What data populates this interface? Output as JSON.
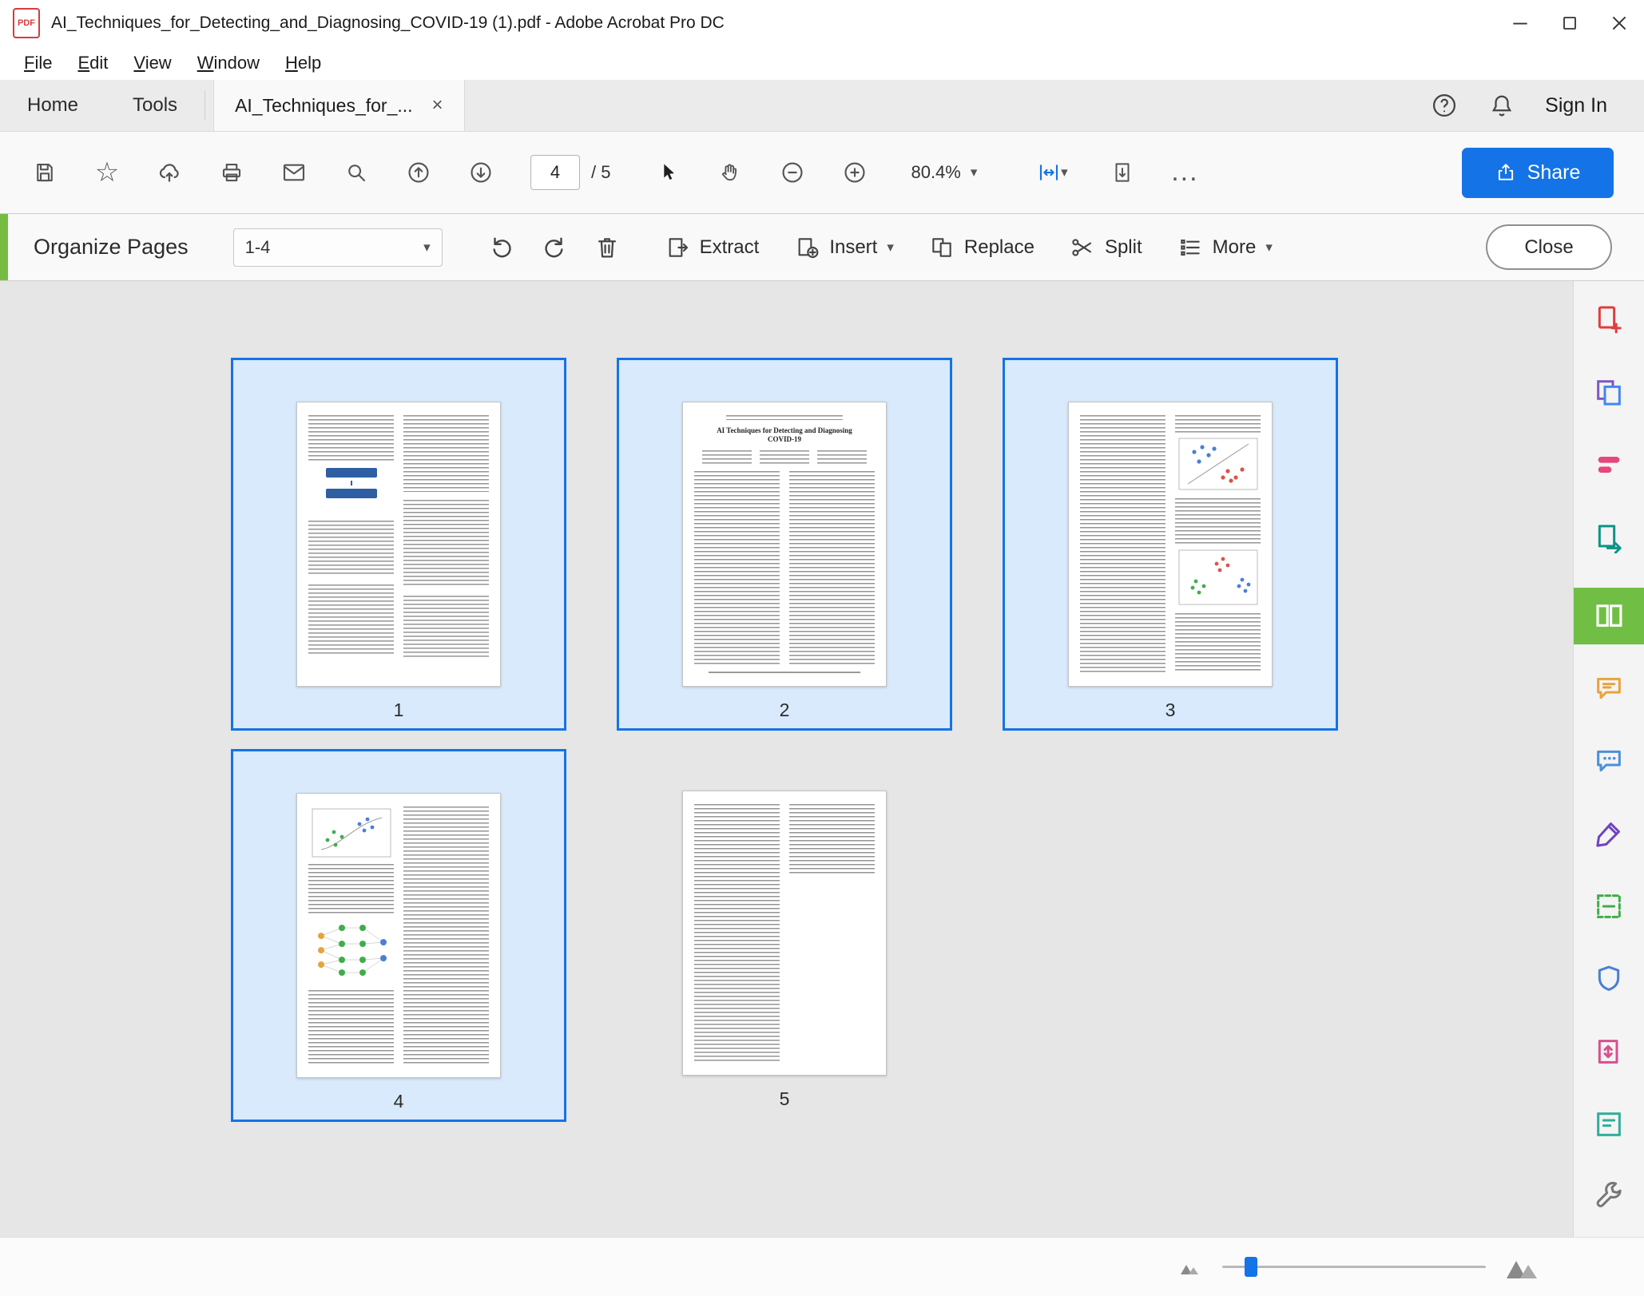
{
  "window": {
    "title": "AI_Techniques_for_Detecting_and_Diagnosing_COVID-19 (1).pdf - Adobe Acrobat Pro DC",
    "pdf_badge": "PDF"
  },
  "menu": {
    "items": [
      "File",
      "Edit",
      "View",
      "Window",
      "Help"
    ]
  },
  "tabbar": {
    "home": "Home",
    "tools": "Tools",
    "document_tab": "AI_Techniques_for_...",
    "sign_in": "Sign In"
  },
  "toolbar": {
    "page_current": "4",
    "page_total": "/ 5",
    "zoom_level": "80.4%",
    "share": "Share",
    "more": "..."
  },
  "organize": {
    "title": "Organize Pages",
    "page_range": "1-4",
    "extract": "Extract",
    "insert": "Insert",
    "replace": "Replace",
    "split": "Split",
    "more": "More",
    "close": "Close"
  },
  "document": {
    "page2_title_line1": "AI Techniques for Detecting and Diagnosing",
    "page2_title_line2": "COVID-19"
  },
  "pages": [
    {
      "number": "1",
      "selected": true
    },
    {
      "number": "2",
      "selected": true
    },
    {
      "number": "3",
      "selected": true
    },
    {
      "number": "4",
      "selected": true
    },
    {
      "number": "5",
      "selected": false
    }
  ],
  "sidebar_tools": [
    {
      "name": "create-pdf"
    },
    {
      "name": "combine-files"
    },
    {
      "name": "edit-pdf"
    },
    {
      "name": "export-pdf"
    },
    {
      "name": "organize-pages",
      "active": true
    },
    {
      "name": "comment"
    },
    {
      "name": "send-for-comments"
    },
    {
      "name": "fill-and-sign"
    },
    {
      "name": "scan-ocr"
    },
    {
      "name": "protect"
    },
    {
      "name": "compress-pdf"
    },
    {
      "name": "prepare-form"
    },
    {
      "name": "customize-tools"
    }
  ],
  "icons": {
    "caret": "▾",
    "close": "×",
    "star": "☆"
  },
  "colors": {
    "accent_blue": "#1473e6",
    "selection_bg": "#d8eafc",
    "selection_border": "#1473e6",
    "organize_green": "#70bf44",
    "share_blue": "#1473e6"
  }
}
